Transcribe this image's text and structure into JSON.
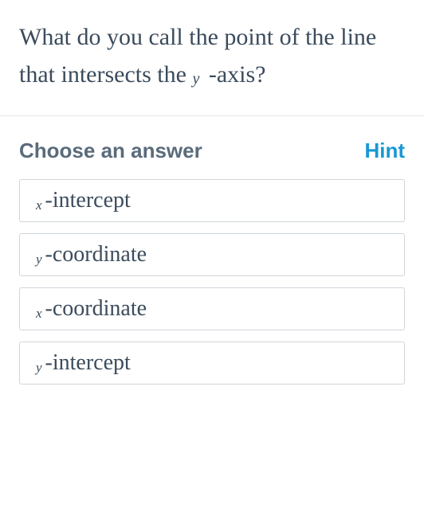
{
  "question": {
    "part1": "What do you call the point of the line that intersects the ",
    "var": "y",
    "part2": " -axis?"
  },
  "chooseLabel": "Choose an answer",
  "hintLabel": "Hint",
  "options": [
    {
      "var": "x",
      "text": "-intercept"
    },
    {
      "var": "y",
      "text": "-coordinate"
    },
    {
      "var": "x",
      "text": "-coordinate"
    },
    {
      "var": "y",
      "text": "-intercept"
    }
  ]
}
